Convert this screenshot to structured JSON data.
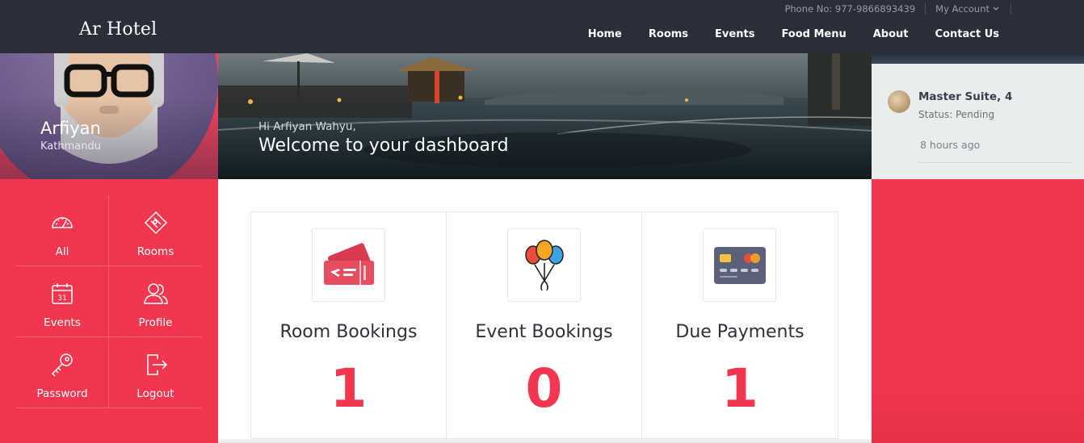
{
  "header": {
    "brand": "Ar Hotel",
    "phone": "Phone No: 977-9866893439",
    "account_label": "My Account",
    "nav": [
      "Home",
      "Rooms",
      "Events",
      "Food Menu",
      "About",
      "Contact Us"
    ]
  },
  "profile": {
    "name": "Arfiyan",
    "location": "Kathmandu"
  },
  "hero": {
    "greeting": "Hi Arfiyan Wahyu,",
    "welcome": "Welcome to your dashboard"
  },
  "notification": {
    "title": "Master Suite, 4",
    "status": "Status: Pending",
    "time": "8 hours ago"
  },
  "menu": [
    {
      "label": "All",
      "icon": "speedometer-icon"
    },
    {
      "label": "Rooms",
      "icon": "ticket-icon"
    },
    {
      "label": "Events",
      "icon": "calendar-icon"
    },
    {
      "label": "Profile",
      "icon": "users-icon"
    },
    {
      "label": "Password",
      "icon": "key-icon"
    },
    {
      "label": "Logout",
      "icon": "logout-icon"
    }
  ],
  "stats": [
    {
      "title": "Room Bookings",
      "value": "1",
      "icon": "tickets-icon"
    },
    {
      "title": "Event Bookings",
      "value": "0",
      "icon": "balloons-icon"
    },
    {
      "title": "Due Payments",
      "value": "1",
      "icon": "credit-card-icon"
    }
  ],
  "colors": {
    "accent": "#f2364f",
    "header_bg": "#2b2d39",
    "text_dark": "#2f3039"
  }
}
